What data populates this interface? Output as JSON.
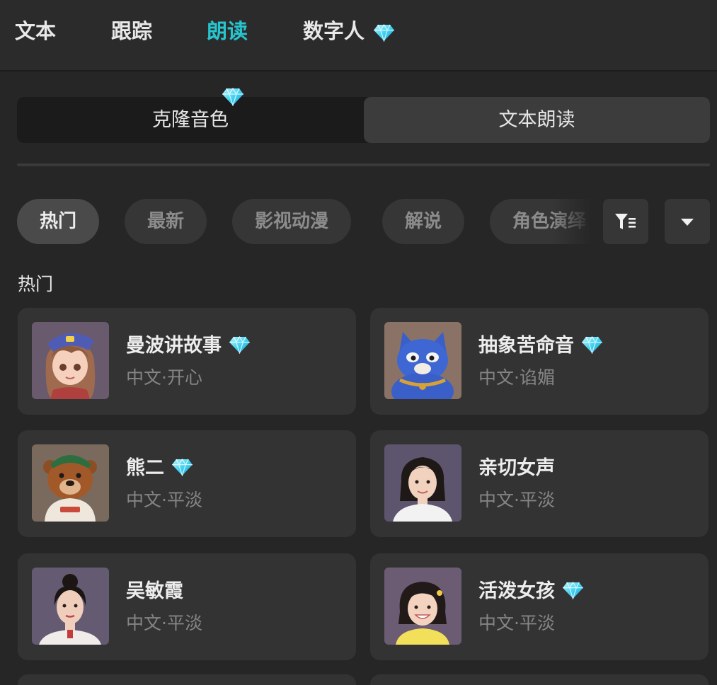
{
  "tabs": [
    {
      "label": "文本"
    },
    {
      "label": "跟踪"
    },
    {
      "label": "朗读"
    },
    {
      "label": "数字人",
      "premium": true
    }
  ],
  "active_tab_index": 2,
  "accent_color": "#27c6cf",
  "segment": {
    "left_label": "克隆音色",
    "left_premium": true,
    "right_label": "文本朗读",
    "selected": "right"
  },
  "categories": [
    "热门",
    "最新",
    "影视动漫",
    "解说",
    "角色演绎"
  ],
  "active_category_index": 0,
  "section_title": "热门",
  "voices": [
    {
      "name": "曼波讲故事",
      "tags": "中文·开心",
      "premium": true,
      "avatar": "anime-girl-avatar"
    },
    {
      "name": "抽象苦命音",
      "tags": "中文·谄媚",
      "premium": true,
      "avatar": "blue-cat-avatar"
    },
    {
      "name": "熊二",
      "tags": "中文·平淡",
      "premium": true,
      "avatar": "bear-avatar"
    },
    {
      "name": "亲切女声",
      "tags": "中文·平淡",
      "premium": false,
      "avatar": "woman-avatar"
    },
    {
      "name": "吴敏霞",
      "tags": "中文·平淡",
      "premium": false,
      "avatar": "woman-avatar"
    },
    {
      "name": "活泼女孩",
      "tags": "中文·平淡",
      "premium": true,
      "avatar": "girl-avatar"
    }
  ]
}
